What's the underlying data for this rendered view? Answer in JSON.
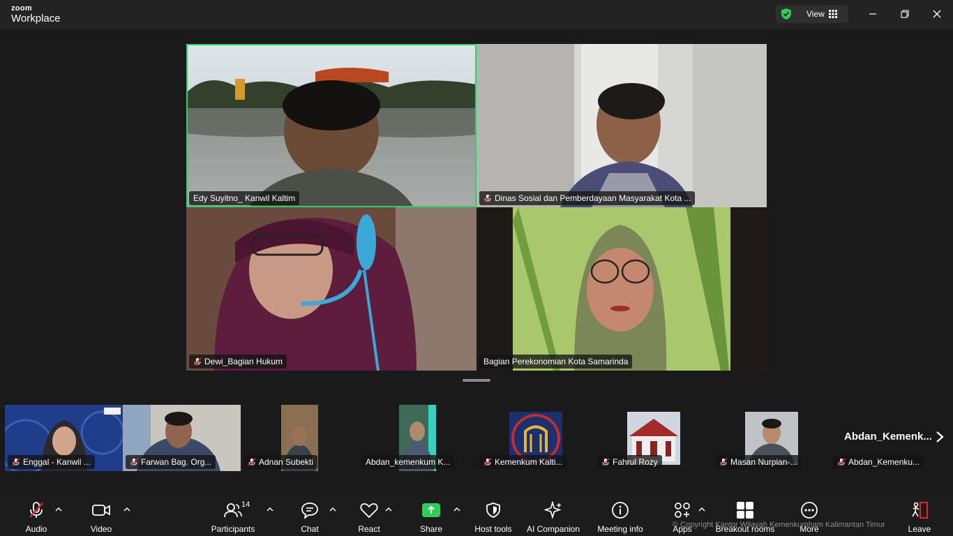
{
  "app": {
    "brand_top": "zoom",
    "brand_bottom": "Workplace"
  },
  "titlebar": {
    "view_label": "View"
  },
  "gallery": [
    {
      "name": "Edy Suyitno_ Kanwil Kaltim",
      "muted": false,
      "active": true
    },
    {
      "name": "Dinas Sosial dan Pemberdayaan Masyarakat Kota ...",
      "muted": true,
      "active": false
    },
    {
      "name": "Dewi_Bagian Hukum",
      "muted": true,
      "active": false
    },
    {
      "name": "Bagian Perekonomian Kota Samarinda",
      "muted": false,
      "active": false
    }
  ],
  "filmstrip": [
    {
      "name": "Enggal - Kanwil ...",
      "muted": true
    },
    {
      "name": "Farwan Bag. Org...",
      "muted": true
    },
    {
      "name": "Adnan Subekti",
      "muted": true
    },
    {
      "name": "Abdan_kemenkum K...",
      "muted": false
    },
    {
      "name": "Kemenkum Kalti...",
      "muted": true
    },
    {
      "name": "Fahrul Rozy",
      "muted": true
    },
    {
      "name": "Masan Nurpian-...",
      "muted": true
    },
    {
      "name": "Abdan_Kemenku...",
      "muted": true
    }
  ],
  "filmstrip_next": "Abdan_Kemenk...",
  "toolbar": {
    "audio": "Audio",
    "video": "Video",
    "participants": "Participants",
    "participants_count": "14",
    "chat": "Chat",
    "react": "React",
    "share": "Share",
    "host_tools": "Host tools",
    "ai_companion": "AI Companion",
    "meeting_info": "Meeting info",
    "apps": "Apps",
    "breakout": "Breakout rooms",
    "more": "More",
    "leave": "Leave"
  },
  "copyright": "© Copyright Kantor Wilayah Kemenkumham Kalimantan Timur",
  "colors": {
    "active_border": "#2cd36b",
    "share": "#2fce5c",
    "leave": "#e02828",
    "mic_off": "#e02828"
  }
}
